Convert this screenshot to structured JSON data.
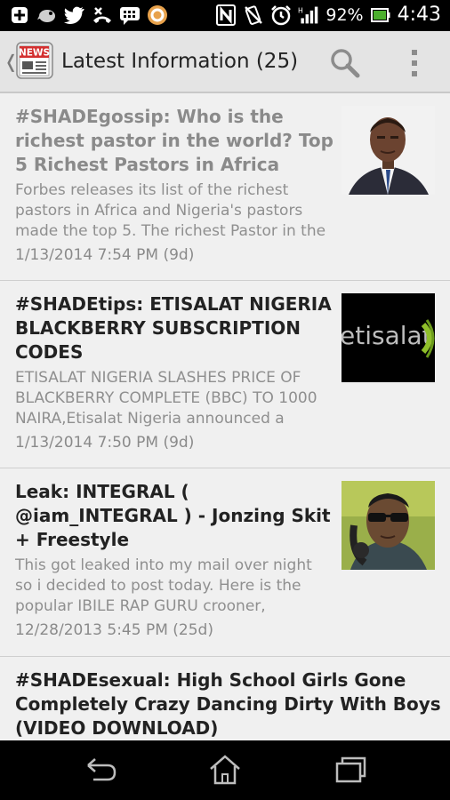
{
  "status_bar": {
    "battery_percent": "92%",
    "time": "4:43",
    "icons": [
      "plus-box-icon",
      "bird-icon",
      "twitter-icon",
      "missed-call-icon",
      "chat-icon",
      "circle-app-icon",
      "nfc-icon",
      "no-sound-icon",
      "alarm-icon",
      "signal-icon",
      "battery-icon"
    ]
  },
  "action_bar": {
    "title": "Latest Information (25)",
    "logo_text": "NEWS",
    "icons": [
      "back-chevron-icon",
      "news-logo-icon",
      "search-icon",
      "overflow-menu-icon"
    ]
  },
  "articles": [
    {
      "title": "#SHADEgossip: Who is the richest pastor in the world? Top 5 Richest Pastors in Africa",
      "snippet": "Forbes releases its list of the richest pastors in Africa and Nigeria's pastors made the top 5.  The richest Pastor in the",
      "date": "1/13/2014 7:54 PM (9d)",
      "read": true,
      "thumbnail": "man-in-suit-photo"
    },
    {
      "title": "#SHADEtips: ETISALAT NIGERIA BLACKBERRY SUBSCRIPTION CODES",
      "snippet": "ETISALAT NIGERIA SLASHES PRICE OF BLACKBERRY COMPLETE (BBC) TO 1000 NAIRA,Etisalat Nigeria  announced a",
      "date": "1/13/2014 7:50 PM (9d)",
      "read": false,
      "thumbnail": "etisalat-logo",
      "thumbnail_text": "etisalat"
    },
    {
      "title": "Leak: INTEGRAL ( @iam_INTEGRAL ) - Jonzing Skit + Freestyle",
      "snippet": "This got leaked into my mail over night so i decided to post today. Here is the popular IBILE RAP GURU crooner,",
      "date": "12/28/2013 5:45 PM (25d)",
      "read": false,
      "thumbnail": "man-with-headphones-photo"
    },
    {
      "title": "#SHADEsexual: High School Girls Gone Completely Crazy Dancing Dirty With Boys (VIDEO DOWNLOAD)",
      "snippet": "",
      "date": "",
      "read": false,
      "thumbnail": ""
    }
  ],
  "nav_bar": {
    "icons": [
      "back-icon",
      "home-icon",
      "recent-apps-icon"
    ]
  },
  "colors": {
    "status_bar_bg": "#000000",
    "action_bar_bg": "#e4e4e4",
    "list_bg": "#f0f0f0",
    "title_text": "#222222",
    "read_title_text": "#8a8a8a",
    "snippet_text": "#8f8f8f",
    "battery_green": "#4caf2e",
    "logo_red": "#d32f2f"
  }
}
